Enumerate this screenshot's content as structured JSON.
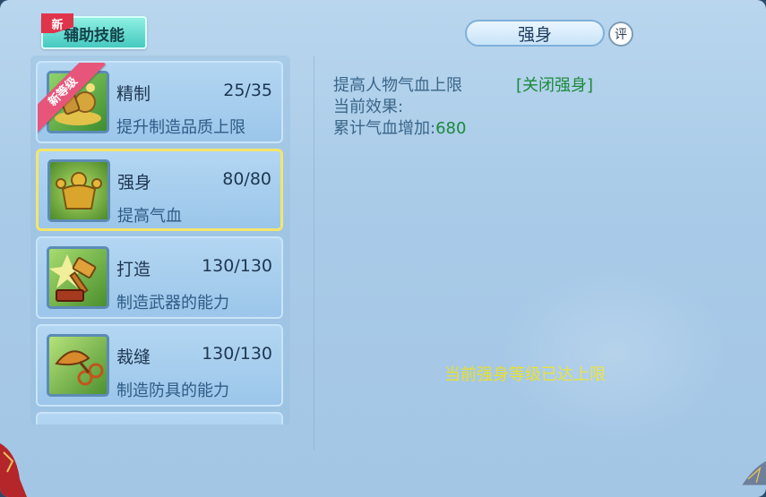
{
  "tab": {
    "label": "辅助技能",
    "new_tag": "新"
  },
  "skills": [
    {
      "name": "精制",
      "level": "25/35",
      "desc": "提升制造品质上限",
      "ribbon": "新等级",
      "icon": "refine-icon"
    },
    {
      "name": "强身",
      "level": "80/80",
      "desc": "提高气血",
      "icon": "strength-icon"
    },
    {
      "name": "打造",
      "level": "130/130",
      "desc": "制造武器的能力",
      "icon": "forge-hammer-icon"
    },
    {
      "name": "裁缝",
      "level": "130/130",
      "desc": "制造防具的能力",
      "icon": "tailor-scissors-icon"
    }
  ],
  "detail": {
    "title": "强身",
    "eval_label": "评",
    "line1": "提高人物气血上限",
    "close_label": "[关闭强身]",
    "line2": "当前效果:",
    "line3_label": "累计气血增加:",
    "line3_value": "680",
    "max_notice": "当前强身等级已达上限"
  },
  "colors": {
    "accent_green": "#1a8a3a",
    "notice_yellow": "#e8df2a",
    "selected_border": "#f4e56c"
  }
}
